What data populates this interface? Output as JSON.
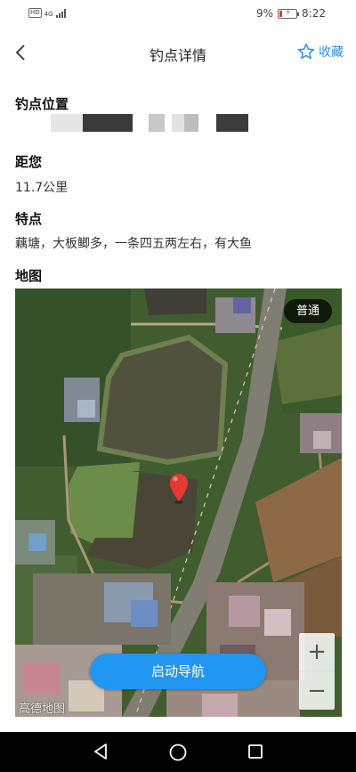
{
  "status_bar": {
    "hd": "HD",
    "network": "4G",
    "battery_percent": "9%",
    "time": "8:22"
  },
  "header": {
    "title": "钓点详情",
    "favorite_label": "收藏",
    "back_icon": "chevron-left-icon",
    "favorite_icon": "star-outline-icon"
  },
  "sections": {
    "location": {
      "title": "钓点位置"
    },
    "distance": {
      "title": "距您",
      "value": "11.7公里"
    },
    "features": {
      "title": "特点",
      "value": "藕塘，大板鲫多，一条四五两左右，有大鱼"
    },
    "map": {
      "title": "地图"
    }
  },
  "map": {
    "type_label": "普通",
    "navigate_label": "启动导航",
    "zoom_in": "+",
    "zoom_out": "−",
    "logo": "高德地图",
    "marker_icon": "map-pin-icon",
    "marker_color": "#e53935"
  },
  "colors": {
    "accent": "#2e8fe0",
    "nav_button": "#2196f3"
  },
  "system_nav": {
    "back_icon": "triangle-back-icon",
    "home_icon": "circle-home-icon",
    "recents_icon": "square-recents-icon"
  }
}
